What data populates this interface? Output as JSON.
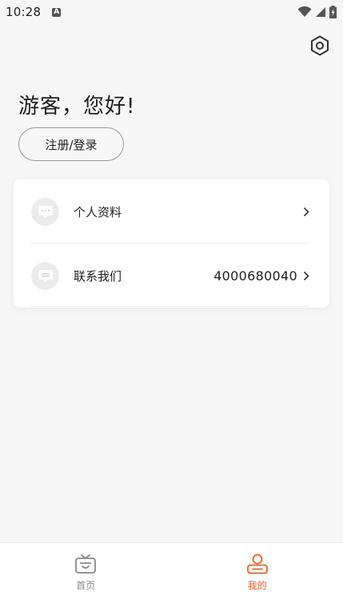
{
  "status_bar": {
    "time": "10:28",
    "notification_glyph": "A",
    "icons": [
      "wifi-icon",
      "signal-icon",
      "battery-charging-icon"
    ]
  },
  "header": {
    "settings_icon": "settings-hexagon-icon"
  },
  "greeting": {
    "text": "游客，您好!",
    "login_button": "注册/登录"
  },
  "menu": {
    "items": [
      {
        "label": "个人资料",
        "value": "",
        "icon": "profile-card-icon"
      },
      {
        "label": "联系我们",
        "value": "4000680040",
        "icon": "contact-card-icon"
      }
    ]
  },
  "bottom_nav": {
    "items": [
      {
        "label": "首页",
        "icon": "home-tv-icon",
        "active": false
      },
      {
        "label": "我的",
        "icon": "user-icon",
        "active": true
      }
    ]
  },
  "colors": {
    "accent": "#e8632b",
    "inactive": "#8a8a8a",
    "background": "#f7f7f7",
    "card": "#ffffff"
  }
}
